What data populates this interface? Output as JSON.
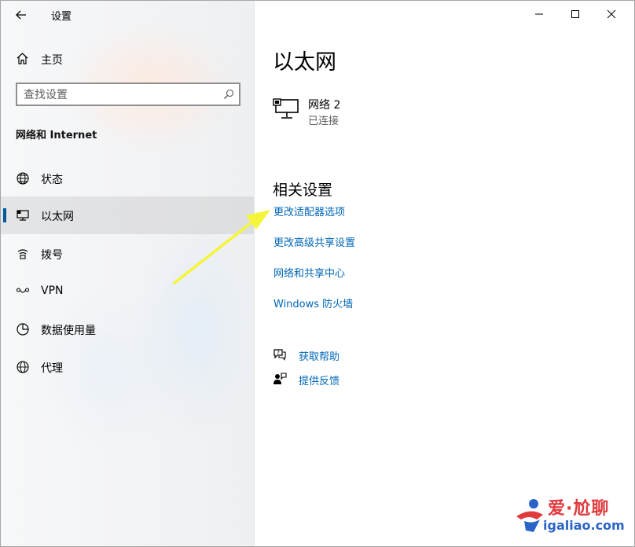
{
  "app": {
    "title": "设置"
  },
  "sidebar": {
    "home_label": "主页",
    "search_placeholder": "查找设置",
    "section_label": "网络和 Internet",
    "items": [
      {
        "label": "状态",
        "icon": "globe-status-icon"
      },
      {
        "label": "以太网",
        "icon": "ethernet-monitor-icon",
        "active": true
      },
      {
        "label": "拨号",
        "icon": "dialup-icon"
      },
      {
        "label": "VPN",
        "icon": "vpn-icon"
      },
      {
        "label": "数据使用量",
        "icon": "data-usage-icon"
      },
      {
        "label": "代理",
        "icon": "globe-proxy-icon"
      }
    ]
  },
  "main": {
    "page_title": "以太网",
    "network": {
      "name": "网络 2",
      "status": "已连接"
    },
    "related_title": "相关设置",
    "links": [
      "更改适配器选项",
      "更改高级共享设置",
      "网络和共享中心",
      "Windows 防火墙"
    ],
    "help": [
      {
        "label": "获取帮助",
        "icon": "help-chat-icon"
      },
      {
        "label": "提供反馈",
        "icon": "feedback-person-icon"
      }
    ]
  },
  "watermark": {
    "logo_text": "爱·尬聊",
    "url": "igaliao.com"
  },
  "colors": {
    "accent": "#0067b8",
    "active_bar": "#005a9e",
    "arrow": "#f5f53a"
  }
}
